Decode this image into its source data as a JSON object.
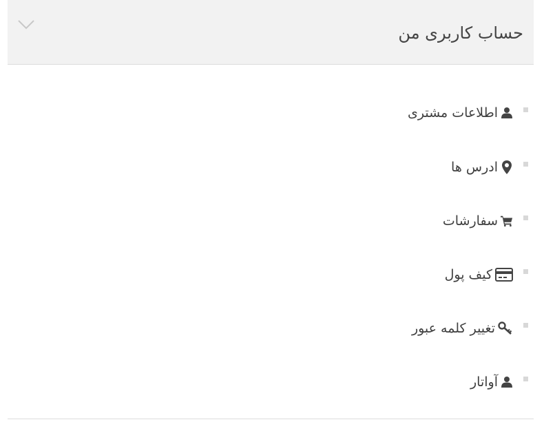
{
  "panel": {
    "title": "حساب کاربری من",
    "toggle_icon": "chevron-down-icon"
  },
  "menu": {
    "items": [
      {
        "label": "اطلاعات مشتری",
        "icon": "user-icon"
      },
      {
        "label": "ادرس ها",
        "icon": "map-marker-icon"
      },
      {
        "label": "سفارشات",
        "icon": "shopping-cart-icon"
      },
      {
        "label": "کیف پول",
        "icon": "credit-card-icon"
      },
      {
        "label": "تغییر کلمه عبور",
        "icon": "key-icon"
      },
      {
        "label": "آواتار",
        "icon": "user-icon"
      }
    ]
  },
  "colors": {
    "header_background": "#f2f2f2",
    "text": "#3f3f3f",
    "bullet": "#d8d8d8",
    "divider": "#dcdcdc"
  }
}
